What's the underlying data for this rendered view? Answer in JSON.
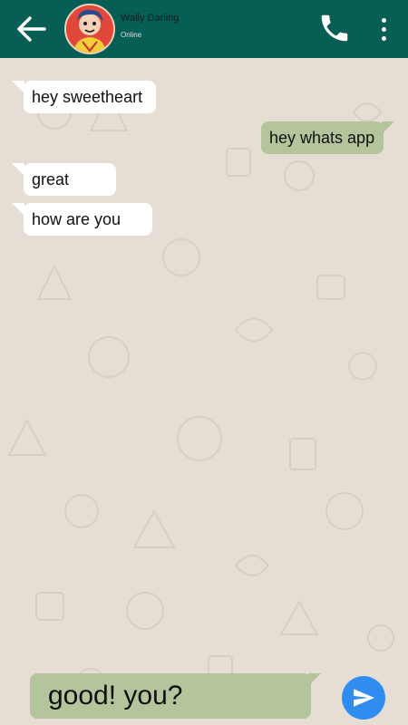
{
  "header": {
    "contact_name": "Wally Darling",
    "status": "Online",
    "back_icon": "arrow-left-icon",
    "call_icon": "phone-icon",
    "menu_icon": "more-vertical-icon"
  },
  "messages": [
    {
      "direction": "incoming",
      "text": "hey sweetheart"
    },
    {
      "direction": "outgoing",
      "text": "hey whats app"
    },
    {
      "direction": "incoming",
      "text": "great"
    },
    {
      "direction": "incoming",
      "text": "how are you"
    }
  ],
  "composer": {
    "value": "good! you?",
    "send_icon": "send-icon"
  },
  "colors": {
    "header": "#075e55",
    "chat_background": "#e6ded5",
    "incoming_bubble": "#ffffff",
    "outgoing_bubble": "#b4c59c",
    "send_button": "#2f8cf0"
  }
}
